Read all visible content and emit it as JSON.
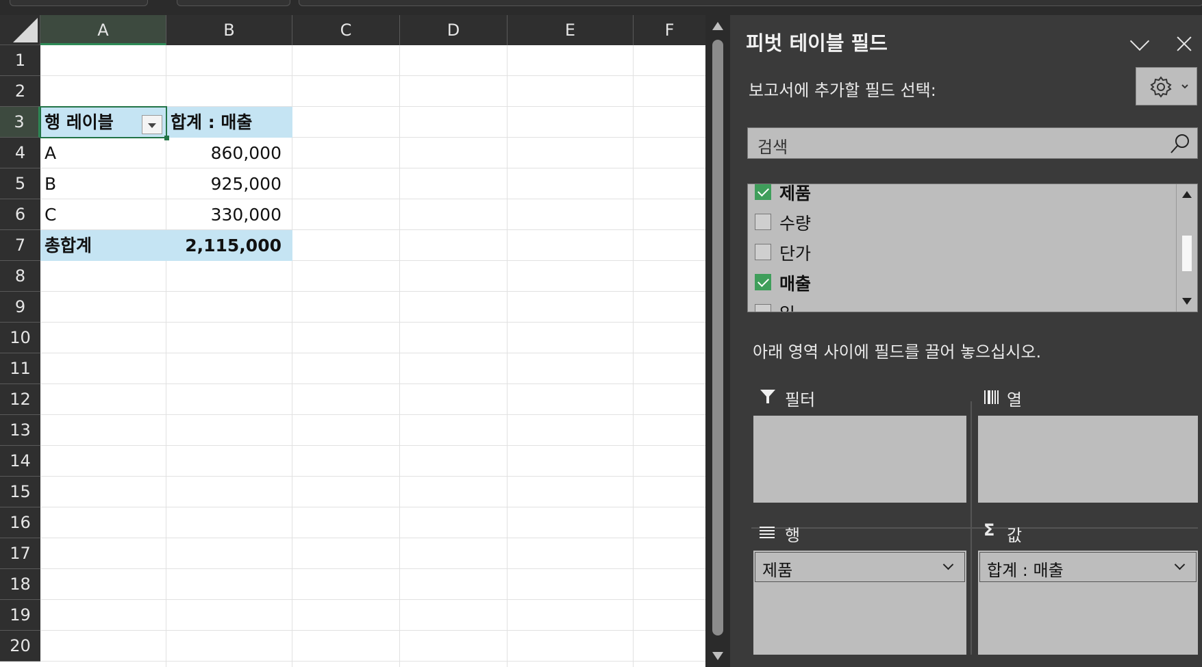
{
  "sheet": {
    "columns": [
      "A",
      "B",
      "C",
      "D",
      "E",
      "F"
    ],
    "rows": [
      "1",
      "2",
      "3",
      "4",
      "5",
      "6",
      "7",
      "8",
      "9",
      "10",
      "11",
      "12",
      "13",
      "14",
      "15",
      "16",
      "17",
      "18",
      "19",
      "20"
    ],
    "pivot": {
      "row_label_header": "행 레이블",
      "value_header": "합계 : 매출",
      "items": [
        {
          "label": "A",
          "value": "860,000"
        },
        {
          "label": "B",
          "value": "925,000"
        },
        {
          "label": "C",
          "value": "330,000"
        }
      ],
      "total_label": "총합계",
      "total_value": "2,115,000"
    }
  },
  "panel": {
    "title": "피벗 테이블 필드",
    "choose_label": "보고서에 추가할 필드 선택:",
    "search_placeholder": "검색",
    "fields": [
      {
        "label": "제품",
        "checked": true
      },
      {
        "label": "수량",
        "checked": false
      },
      {
        "label": "단가",
        "checked": false
      },
      {
        "label": "매출",
        "checked": true
      },
      {
        "label": "일",
        "checked": false
      }
    ],
    "drag_hint": "아래 영역 사이에 필드를 끌어 놓으십시오.",
    "areas": {
      "filter": "필터",
      "columns": "열",
      "rows": "행",
      "values": "값"
    },
    "row_pill": "제품",
    "value_pill": "합계 : 매출"
  },
  "colors": {
    "pivot_header_bg": "#c5e4f3",
    "accent_green": "#217346",
    "panel_bg": "#3a3a3a",
    "area_bg": "#bdbdbd"
  }
}
